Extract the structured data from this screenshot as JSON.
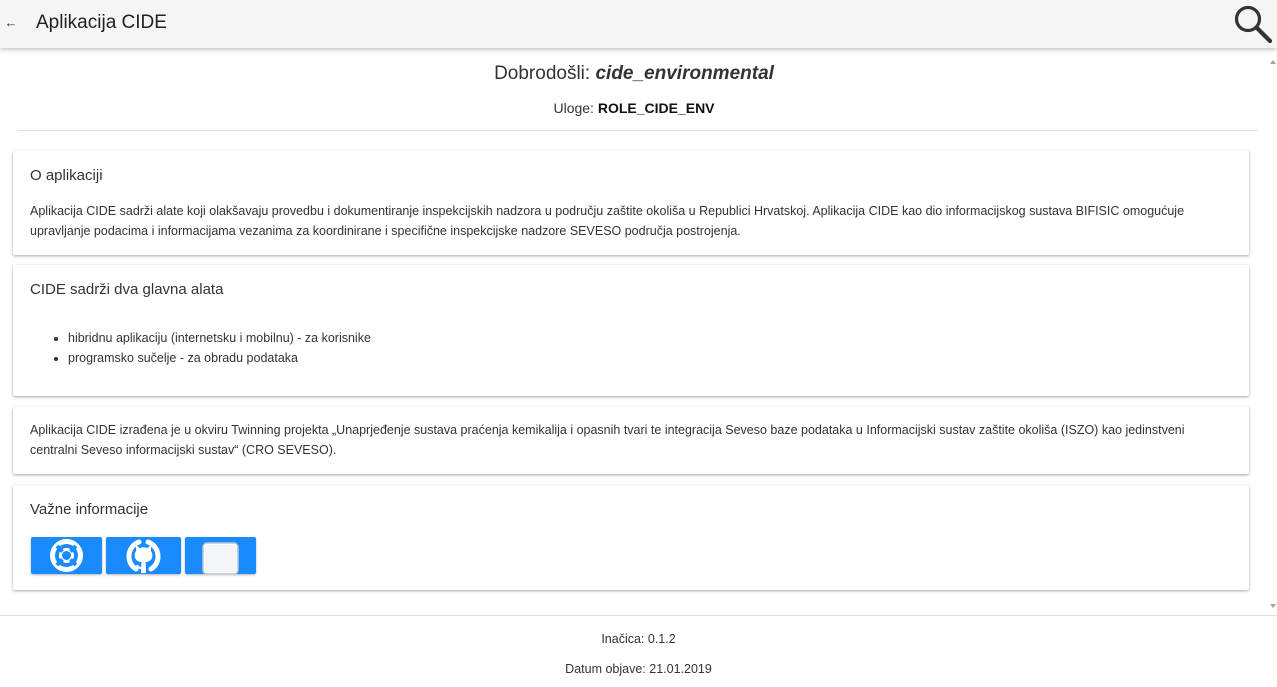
{
  "header": {
    "back_icon": "arrow-left-icon",
    "back_glyph": "←",
    "title": "Aplikacija CIDE",
    "search_icon": "search-icon"
  },
  "welcome": {
    "prefix": "Dobrodošli: ",
    "username": "cide_environmental",
    "roles_label": "Uloge: ",
    "roles_value": "ROLE_CIDE_ENV"
  },
  "about": {
    "title": "O aplikaciji",
    "text": "Aplikacija CIDE sadrži alate koji olakšavaju provedbu i dokumentiranje inspekcijskih nadzora u području zaštite okoliša u Republici Hrvatskoj. Aplikacija CIDE kao dio informacijskog sustava BIFISIC omogućuje upravljanje podacima i informacijama vezanima za koordinirane i specifične inspekcijske nadzore SEVESO područja postrojenja."
  },
  "tools": {
    "title": "CIDE sadrži dva glavna alata",
    "items": [
      "hibridnu aplikaciju (internetsku i mobilnu) - za korisnike",
      "programsko sučelje - za obradu podataka"
    ]
  },
  "project": {
    "text": "Aplikacija CIDE izrađena je u okviru Twinning projekta „Unaprjeđenje sustava praćenja kemikalija i opasnih tvari te integracija Seveso baze podataka u Informacijski sustav zaštite okoliša (ISZO) kao jedinstveni centralni Seveso informacijski sustav“ (CRO SEVESO)."
  },
  "important": {
    "title": "Važne informacije",
    "buttons": [
      {
        "icon": "lifebuoy-icon"
      },
      {
        "icon": "github-icon"
      },
      {
        "icon": "window-icon"
      }
    ]
  },
  "footer": {
    "version": "Inačica: 0.1.2",
    "release_date": "Datum objave: 21.01.2019"
  },
  "colors": {
    "accent": "#1a8bff",
    "topbar": "#f5f5f5"
  }
}
